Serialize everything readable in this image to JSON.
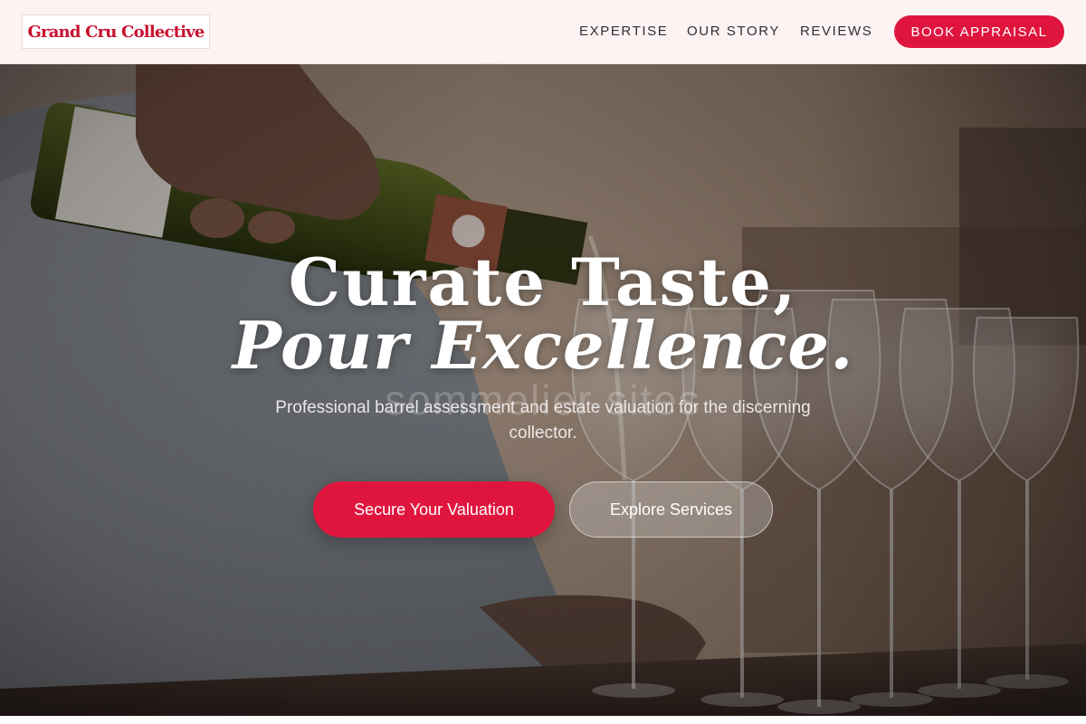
{
  "header": {
    "logo": "Grand Cru Collective",
    "nav": [
      "EXPERTISE",
      "OUR STORY",
      "REVIEWS"
    ],
    "cta": "BOOK APPRAISAL"
  },
  "hero": {
    "title_line1": "Curate Taste,",
    "title_line2": "Pour Excellence.",
    "ghost_text": "sommelier sites",
    "subtitle": "Professional barrel assessment and estate valuation for the discerning collector.",
    "primary_button": "Secure Your Valuation",
    "secondary_button": "Explore Services",
    "image_icon": "wine-pour-photo-icon"
  },
  "colors": {
    "accent": "#e0153e",
    "logo": "#c8102e",
    "header_bg": "#fdf3f3",
    "nav_text": "#2f2f36"
  }
}
